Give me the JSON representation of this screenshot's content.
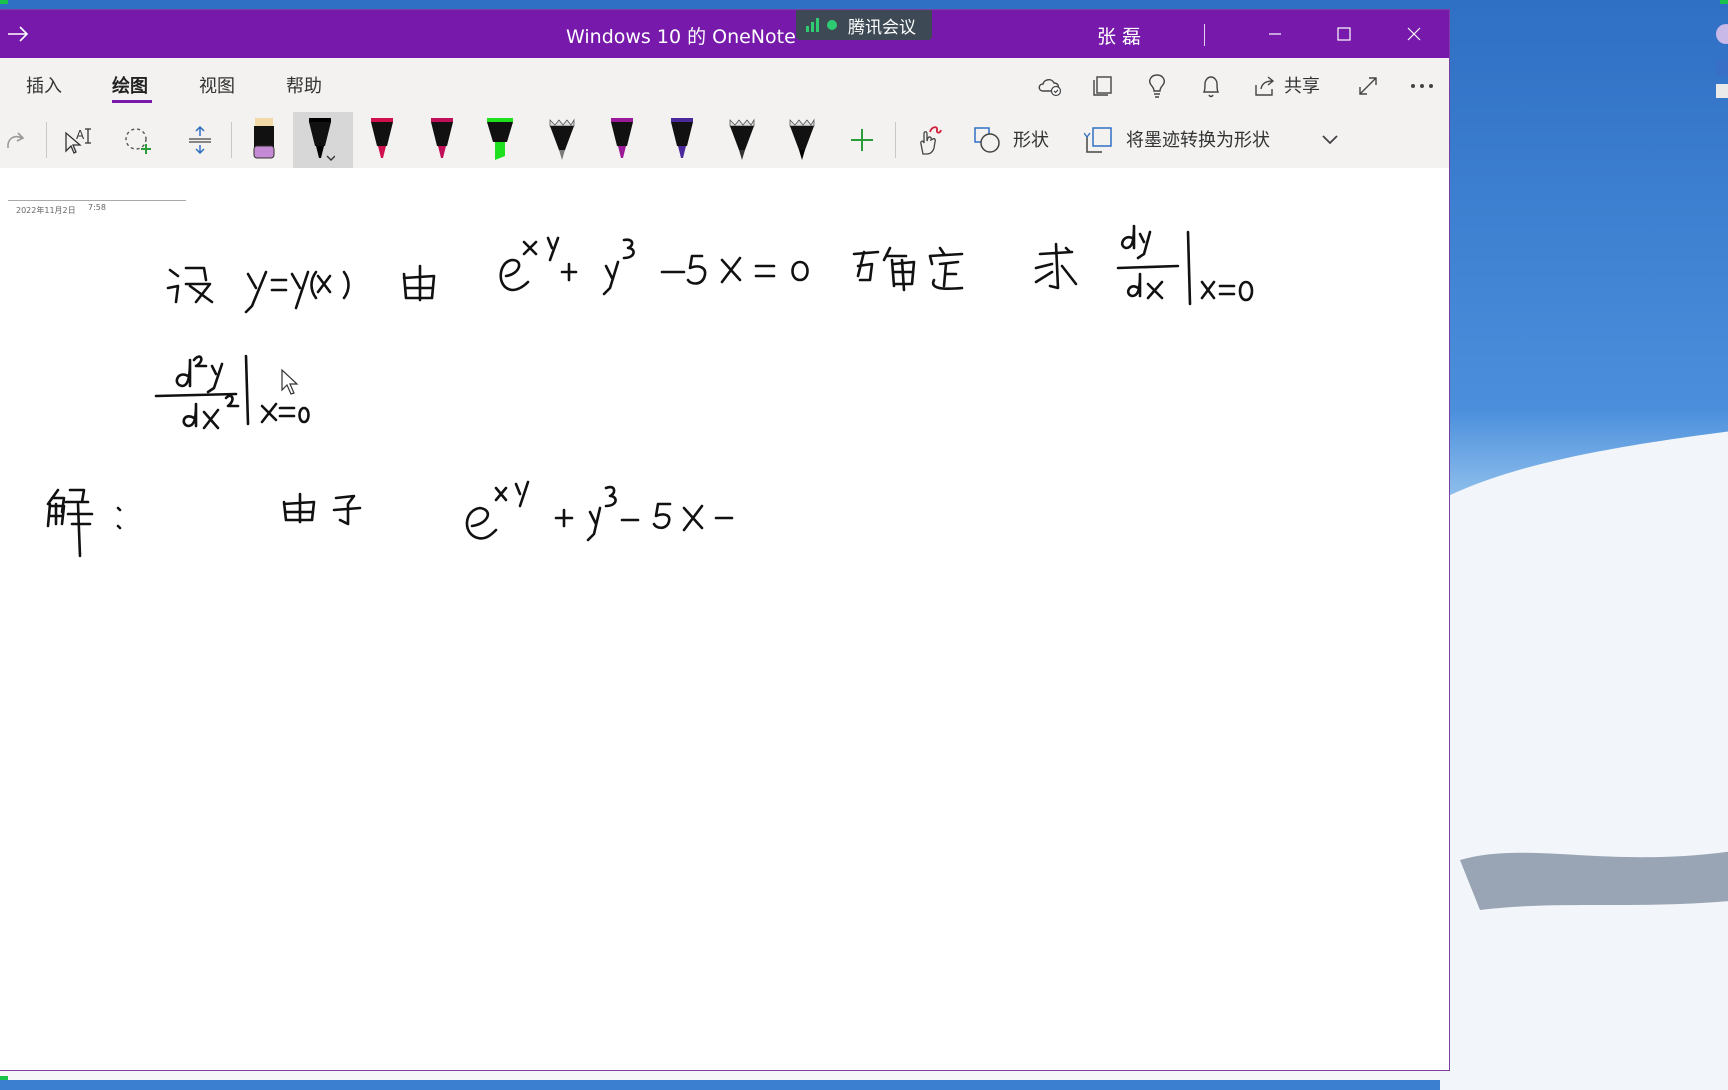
{
  "window": {
    "title": "Windows 10 的 OneNote",
    "user": "张 磊"
  },
  "overlay": {
    "meeting_app": "腾讯会议"
  },
  "ribbon": {
    "tabs": [
      {
        "label": "插入",
        "active": false
      },
      {
        "label": "绘图",
        "active": true
      },
      {
        "label": "视图",
        "active": false
      },
      {
        "label": "帮助",
        "active": false
      }
    ],
    "share_label": "共享"
  },
  "draw_toolbar": {
    "shapes_label": "形状",
    "ink_to_shape_label": "将墨迹转换为形状",
    "pens": [
      {
        "kind": "eraser",
        "color": "#c58ad6"
      },
      {
        "kind": "pen",
        "color": "#000000",
        "selected": true
      },
      {
        "kind": "pen",
        "color": "#d0104c"
      },
      {
        "kind": "pen",
        "color": "#c0105a"
      },
      {
        "kind": "highlighter",
        "color": "#1fe01f"
      },
      {
        "kind": "pencil",
        "color": "#7a7a7a"
      },
      {
        "kind": "pen",
        "color": "#9a1a9a"
      },
      {
        "kind": "pen",
        "color": "#4a2a9a"
      },
      {
        "kind": "pencil",
        "color": "#333333"
      },
      {
        "kind": "pencil",
        "color": "#000000"
      }
    ]
  },
  "page": {
    "date": "2022年11月2日",
    "time": "7:58"
  },
  "colors": {
    "accent": "#7719aa",
    "ribbon_bg": "#f3f2f1"
  }
}
